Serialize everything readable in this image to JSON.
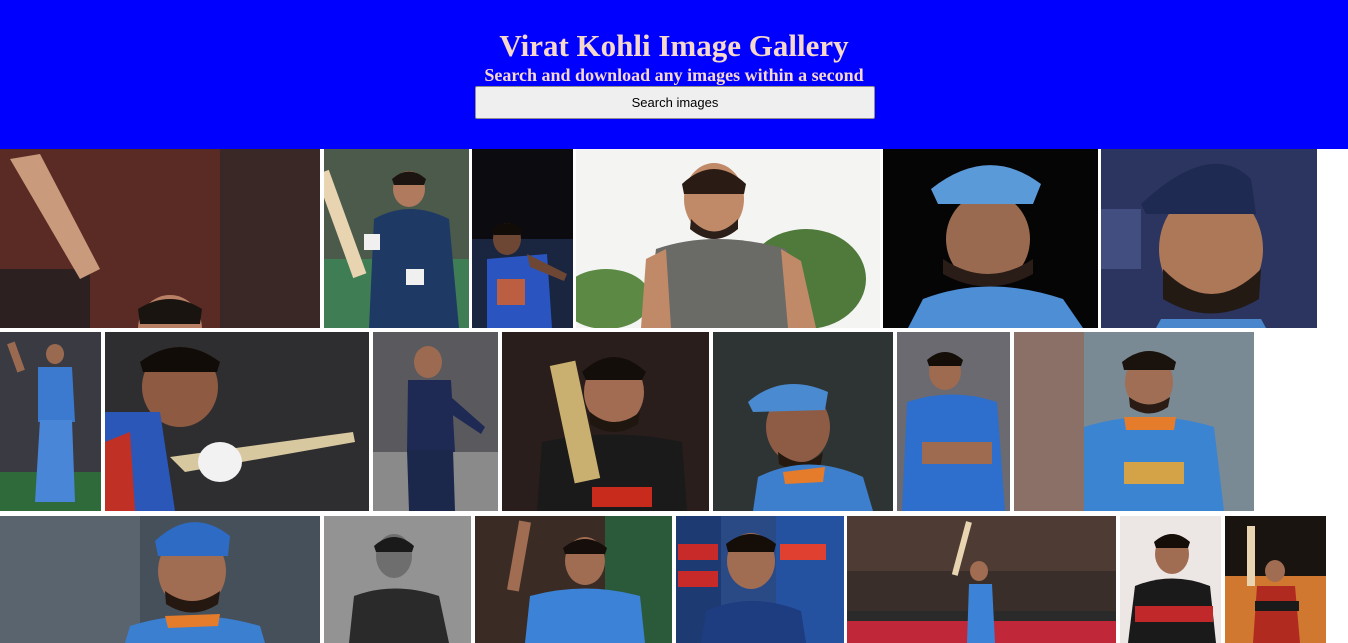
{
  "header": {
    "title": "Virat Kohli Image Gallery",
    "subtitle": "Search and download any images within a second",
    "search_placeholder": "Search images",
    "background": "#0000ff",
    "text_color": "#f5d7cc"
  },
  "gallery": {
    "image_alt": "Virat Kohli"
  }
}
